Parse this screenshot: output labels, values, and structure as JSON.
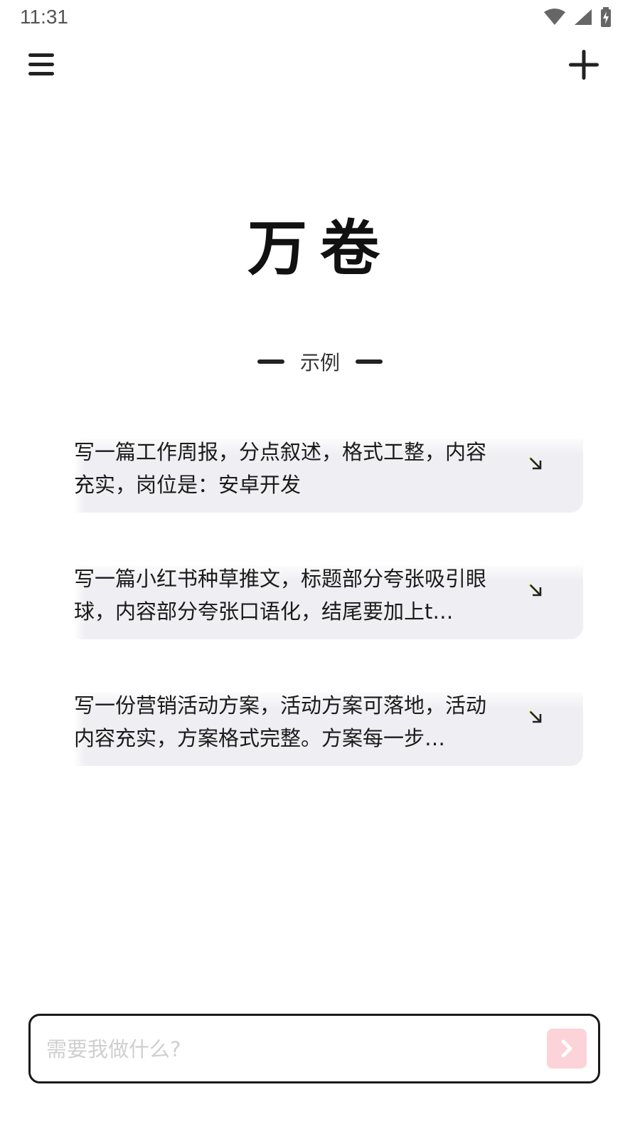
{
  "status_bar": {
    "time": "11:31",
    "icons": [
      "wifi-icon",
      "signal-icon",
      "battery-icon"
    ]
  },
  "toolbar": {
    "menu_icon": "hamburger-menu-icon",
    "add_icon": "plus-icon"
  },
  "app": {
    "title": "万卷"
  },
  "examples": {
    "label": "示例",
    "items": [
      {
        "text": "写一篇工作周报，分点叙述，格式工整，内容充实，岗位是：安卓开发",
        "icon": "arrow-down-right-icon"
      },
      {
        "text": "写一篇小红书种草推文，标题部分夸张吸引眼球，内容部分夸张口语化，结尾要加上t…",
        "icon": "arrow-down-right-icon"
      },
      {
        "text": "写一份营销活动方案，活动方案可落地，活动内容充实，方案格式完整。方案每一步…",
        "icon": "arrow-down-right-icon"
      }
    ]
  },
  "input": {
    "placeholder": "需要我做什么?",
    "value": "",
    "send_icon": "chevron-right-icon"
  },
  "colors": {
    "card_background": "#efeff3",
    "send_button": "#fbd3d8",
    "send_icon": "#ffffff",
    "arrow_accent": "#a6c21e"
  }
}
